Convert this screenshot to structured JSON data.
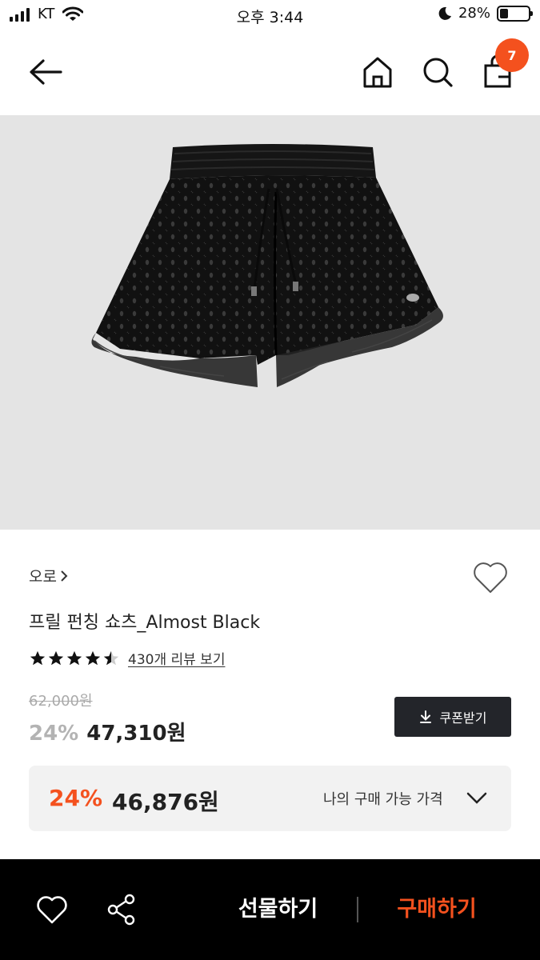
{
  "status_bar": {
    "carrier": "KT",
    "time": "오후 3:44",
    "battery_percent": "28%",
    "battery_level": 0.28
  },
  "header": {
    "back_icon": "arrow-left-icon",
    "home_icon": "home-icon",
    "search_icon": "search-icon",
    "bag_icon": "shopping-bag-icon",
    "cart_count": "7",
    "badge_color": "#f4511e"
  },
  "product": {
    "image_description_icon": "black-shorts-image",
    "brand": "오로",
    "name": "프릴 펀칭 쇼츠_Almost Black",
    "rating": 4.5,
    "review_link": "430개 리뷰 보기",
    "original_price": "62,000원",
    "discount_percent": "24%",
    "sale_price": "47,310원",
    "coupon_button": "쿠폰받기",
    "my_price": {
      "discount_percent": "24%",
      "price": "46,876원",
      "label": "나의 구매 가능 가격"
    }
  },
  "bottom_bar": {
    "gift_label": "선물하기",
    "buy_label": "구매하기",
    "accent_color": "#f4511e"
  }
}
